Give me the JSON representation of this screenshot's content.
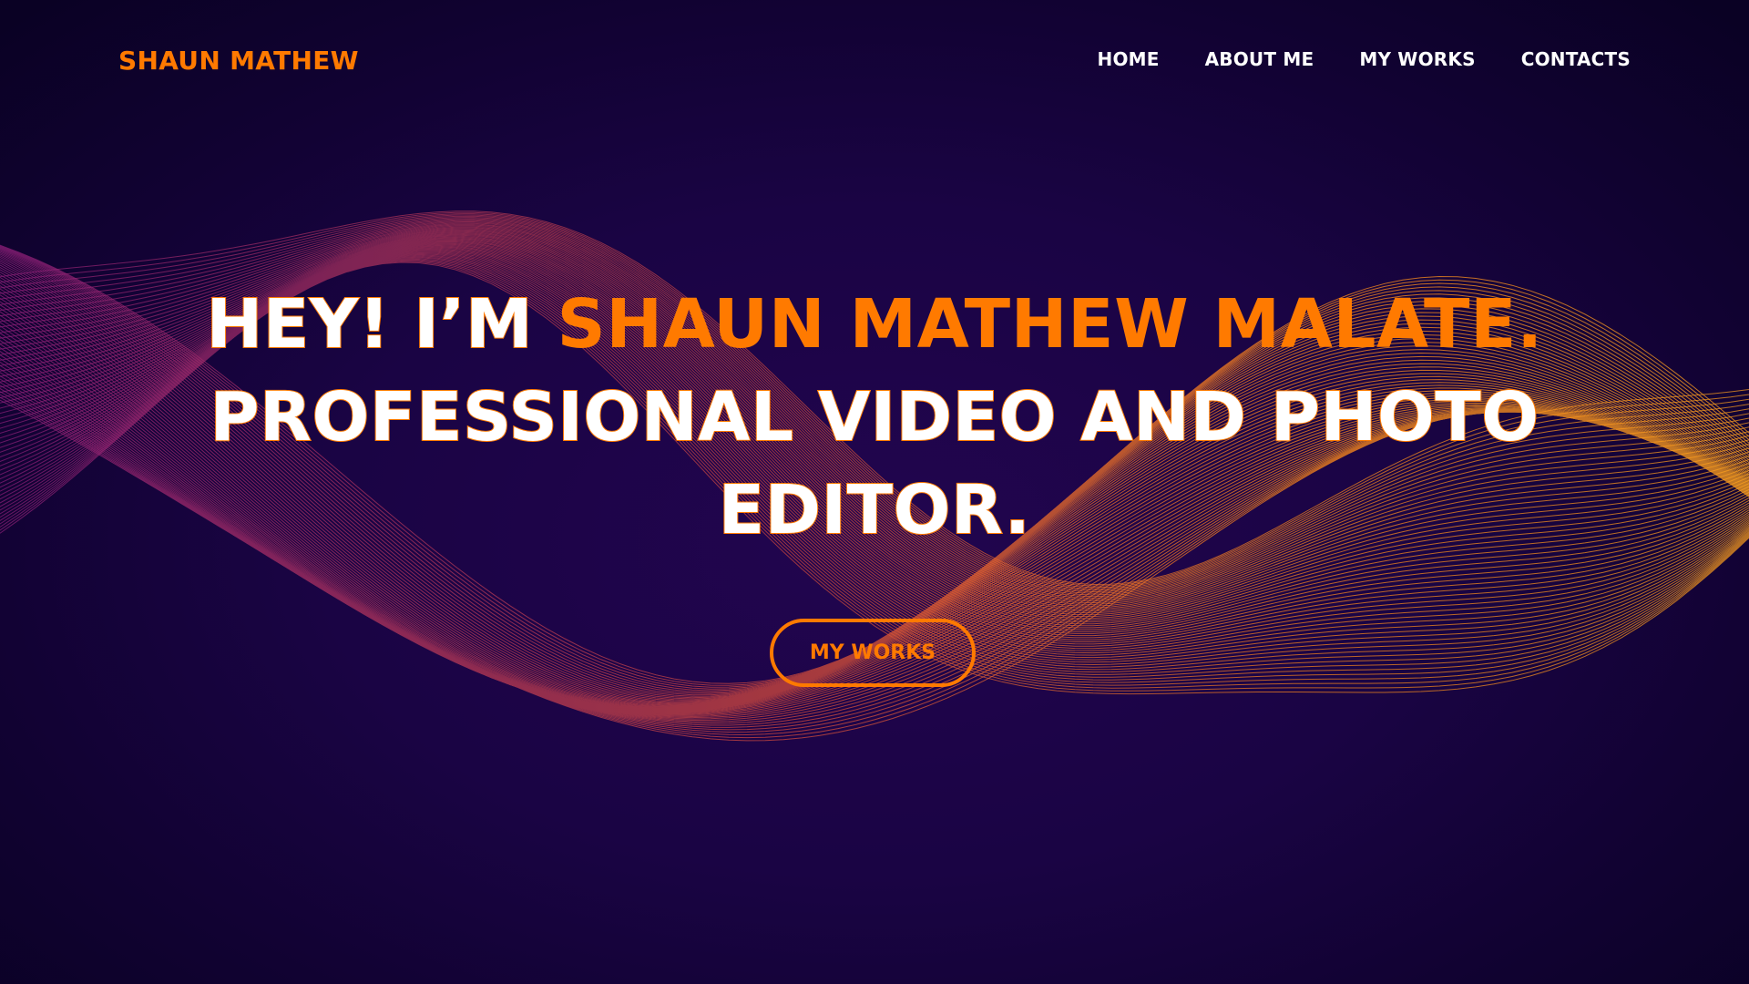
{
  "theme": {
    "background": "#1a0444",
    "accent": "#ff7a00",
    "text": "#ffffff",
    "wave_start": "#8e1f7a",
    "wave_end": "#ffa21e"
  },
  "navbar": {
    "logo": "SHAUN MATHEW",
    "links": [
      {
        "label": "HOME"
      },
      {
        "label": "ABOUT ME"
      },
      {
        "label": "MY WORKS"
      },
      {
        "label": "CONTACTS"
      }
    ]
  },
  "hero": {
    "greeting": "HEY! I’M ",
    "name": "SHAUN MATHEW MALATE.",
    "tagline": "PROFESSIONAL VIDEO AND PHOTO EDITOR.",
    "cta_label": "MY WORKS"
  }
}
